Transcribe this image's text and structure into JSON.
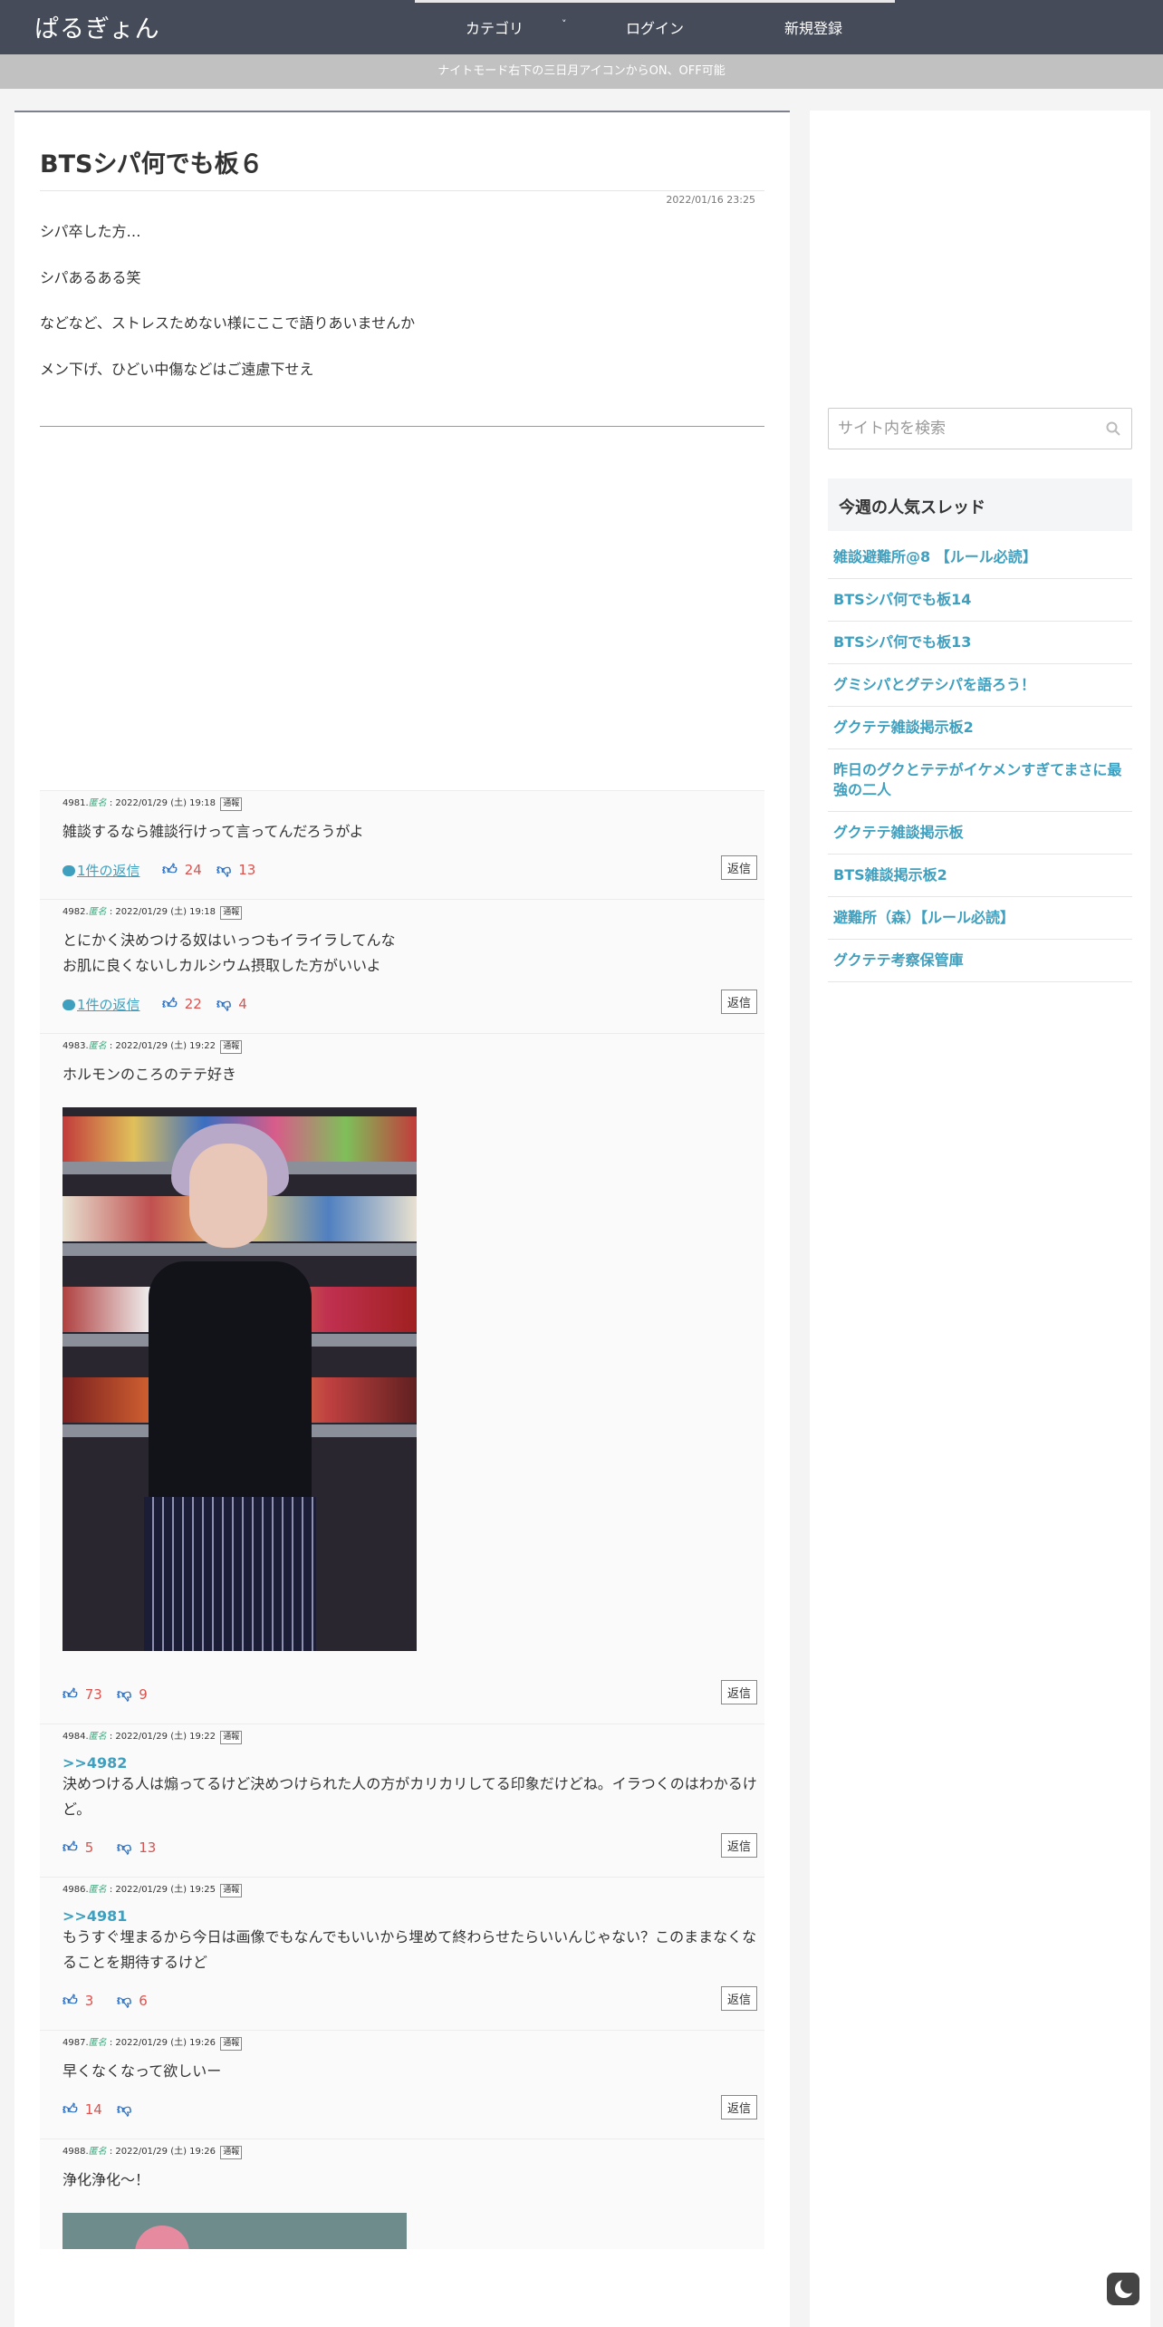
{
  "header": {
    "logo": "ぱるぎょん",
    "nav": {
      "category": "カテゴリ",
      "login": "ログイン",
      "register": "新規登録"
    }
  },
  "notice": "ナイトモード右下の三日月アイコンからON、OFF可能",
  "post": {
    "title": "BTSシパ何でも板６",
    "date": "2022/01/16 23:25",
    "body": [
      "シパ卒した方…",
      "シパあるある笑",
      "などなど、ストレスためない様にここで語りあいませんか",
      "メン下げ、ひどい中傷などはご遠慮下せえ"
    ]
  },
  "comments": [
    {
      "num": "4981.",
      "name": "匿名",
      "date": "2022/01/29 (土) 19:18",
      "report": "通報",
      "reply_to": "",
      "text": "雑談するなら雑談行けって言ってんだろうがよ",
      "replies": "1件の返信",
      "up": "24",
      "down": "13",
      "reply_btn": "返信"
    },
    {
      "num": "4982.",
      "name": "匿名",
      "date": "2022/01/29 (土) 19:18",
      "report": "通報",
      "reply_to": "",
      "text": "とにかく決めつける奴はいっつもイライラしてんな\nお肌に良くないしカルシウム摂取した方がいいよ",
      "replies": "1件の返信",
      "up": "22",
      "down": "4",
      "reply_btn": "返信"
    },
    {
      "num": "4983.",
      "name": "匿名",
      "date": "2022/01/29 (土) 19:22",
      "report": "通報",
      "reply_to": "",
      "text": "ホルモンのころのテテ好き",
      "replies": "",
      "up": "73",
      "down": "9",
      "reply_btn": "返信"
    },
    {
      "num": "4984.",
      "name": "匿名",
      "date": "2022/01/29 (土) 19:22",
      "report": "通報",
      "reply_to": ">>4982",
      "text": "決めつける人は煽ってるけど決めつけられた人の方がカリカリしてる印象だけどね。イラつくのはわかるけど。",
      "replies": "",
      "up": "5",
      "down": "13",
      "reply_btn": "返信"
    },
    {
      "num": "4986.",
      "name": "匿名",
      "date": "2022/01/29 (土) 19:25",
      "report": "通報",
      "reply_to": ">>4981",
      "text": "もうすぐ埋まるから今日は画像でもなんでもいいから埋めて終わらせたらいいんじゃない？このままなくなることを期待するけど",
      "replies": "",
      "up": "3",
      "down": "6",
      "reply_btn": "返信"
    },
    {
      "num": "4987.",
      "name": "匿名",
      "date": "2022/01/29 (土) 19:26",
      "report": "通報",
      "reply_to": "",
      "text": "早くなくなって欲しいー",
      "replies": "",
      "up": "14",
      "down": "",
      "reply_btn": "返信"
    },
    {
      "num": "4988.",
      "name": "匿名",
      "date": "2022/01/29 (土) 19:26",
      "report": "通報",
      "reply_to": "",
      "text": "浄化浄化〜！",
      "replies": "",
      "up": "",
      "down": "",
      "reply_btn": ""
    }
  ],
  "sidebar": {
    "search_placeholder": "サイト内を検索",
    "popular_heading": "今週の人気スレッド",
    "popular": [
      "雑談避難所@8 【ルール必読】",
      "BTSシパ何でも板14",
      "BTSシパ何でも板13",
      "グミシパとグテシパを語ろう！",
      "グクテテ雑談掲示板2",
      "昨日のグクとテテがイケメンすぎてまさに最強の二人",
      "グクテテ雑談掲示板",
      "BTS雑談掲示板2",
      "避難所（森）【ルール必読】",
      "グクテテ考察保管庫"
    ]
  },
  "colors": {
    "header": "#454b59",
    "link": "#3f9fbf",
    "vote_count": "#d9534f",
    "thumb": "#2b70c2"
  }
}
